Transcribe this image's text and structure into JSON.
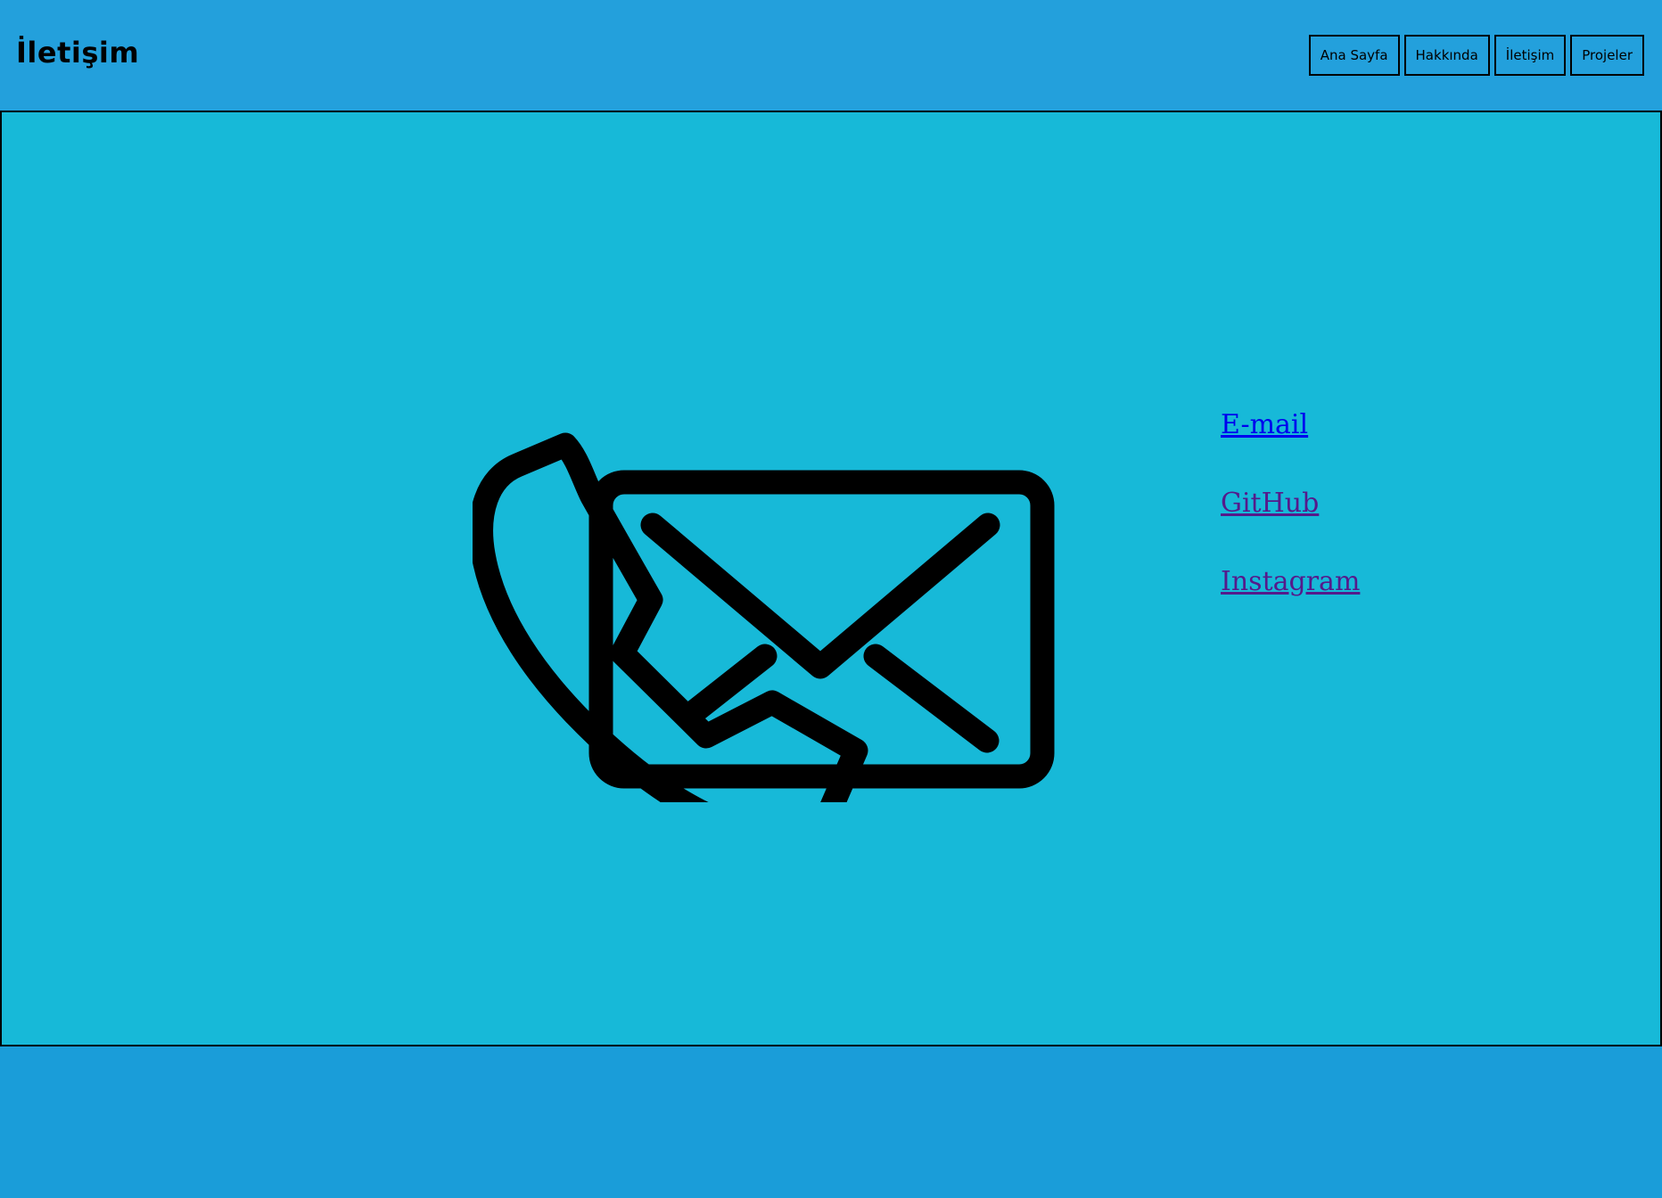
{
  "header": {
    "title": "İletişim",
    "nav": [
      "Ana Sayfa",
      "Hakkında",
      "İletişim",
      "Projeler"
    ]
  },
  "main": {
    "icon": "phone-envelope-icon",
    "links": {
      "email": "E-mail",
      "github": "GitHub",
      "instagram": "Instagram"
    }
  },
  "colors": {
    "header_bg": "#23a0dc",
    "main_bg": "#17b9d8",
    "page_bg": "#1a9dd9",
    "link": "#0000ee",
    "visited_link": "#551a8b"
  }
}
